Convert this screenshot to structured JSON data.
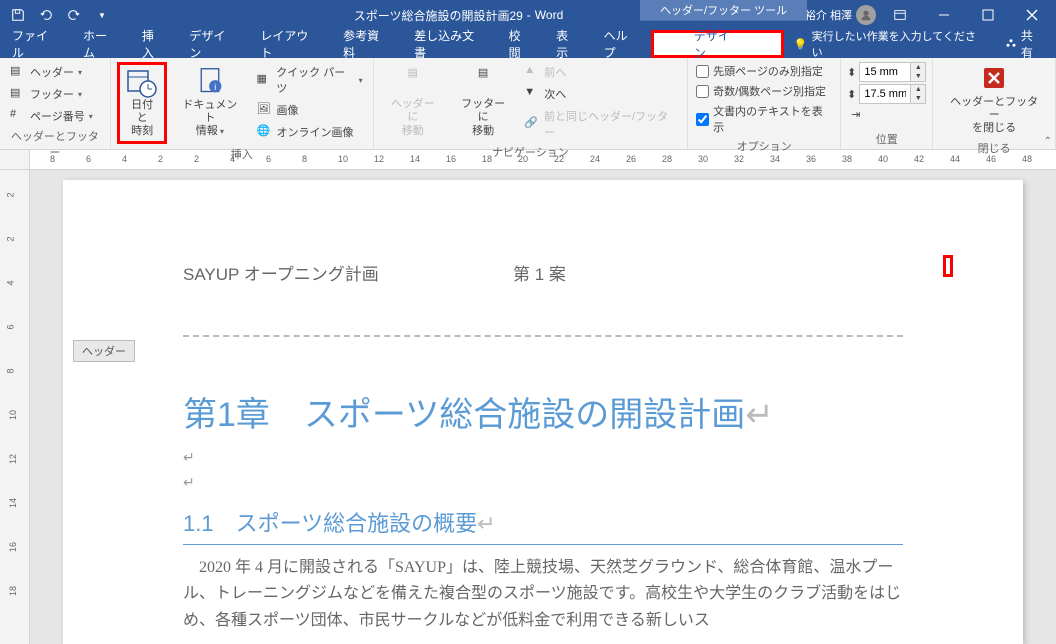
{
  "titlebar": {
    "doc_title": "スポーツ総合施設の開設計画29",
    "app": "Word",
    "contextual_tools": "ヘッダー/フッター ツール",
    "user": "裕介 相澤"
  },
  "menubar": {
    "file": "ファイル",
    "home": "ホーム",
    "insert": "挿入",
    "design": "デザイン",
    "layout": "レイアウト",
    "references": "参考資料",
    "mailings": "差し込み文書",
    "review": "校閲",
    "view": "表示",
    "help": "ヘルプ",
    "hf_design": "デザイン",
    "tell_me": "実行したい作業を入力してください",
    "share": "共有"
  },
  "ribbon": {
    "g_hf": {
      "header": "ヘッダー",
      "footer": "フッター",
      "pagenum": "ページ番号",
      "label": "ヘッダーとフッター"
    },
    "g_insert": {
      "datetime": "日付と\n時刻",
      "docinfo": "ドキュメント\n情報",
      "quickparts": "クイック パーツ",
      "image": "画像",
      "online_image": "オンライン画像",
      "label": "挿入"
    },
    "g_nav": {
      "goto_header": "ヘッダーに\n移動",
      "goto_footer": "フッターに\n移動",
      "prev": "前へ",
      "next": "次へ",
      "same_as_prev": "前と同じヘッダー/フッター",
      "label": "ナビゲーション"
    },
    "g_options": {
      "first_diff": "先頭ページのみ別指定",
      "odd_even": "奇数/偶数ページ別指定",
      "show_text": "文書内のテキストを表示",
      "label": "オプション"
    },
    "g_position": {
      "top_value": "15 mm",
      "bottom_value": "17.5 mm",
      "label": "位置"
    },
    "g_close": {
      "close": "ヘッダーとフッター\nを閉じる",
      "label": "閉じる"
    }
  },
  "header_tag": "ヘッダー",
  "doc": {
    "header_left": "SAYUP オープニング計画",
    "header_center": "第 1 案",
    "h1": "第1章　スポーツ総合施設の開設計画",
    "h2": "1.1　スポーツ総合施設の概要",
    "body": "2020 年 4 月に開設される「SAYUP」は、陸上競技場、天然芝グラウンド、総合体育館、温水プール、トレーニングジムなどを備えた複合型のスポーツ施設です。高校生や大学生のクラブ活動をはじめ、各種スポーツ団体、市民サークルなどが低料金で利用できる新しいス"
  },
  "ruler_h": [
    "8",
    "6",
    "4",
    "2",
    "2",
    "4",
    "6",
    "8",
    "10",
    "12",
    "14",
    "16",
    "18",
    "20",
    "22",
    "24",
    "26",
    "28",
    "30",
    "32",
    "34",
    "36",
    "38",
    "40",
    "42",
    "44",
    "46",
    "48"
  ],
  "ruler_v": [
    "2",
    "2",
    "4",
    "6",
    "8",
    "10",
    "12",
    "14",
    "16",
    "18"
  ]
}
